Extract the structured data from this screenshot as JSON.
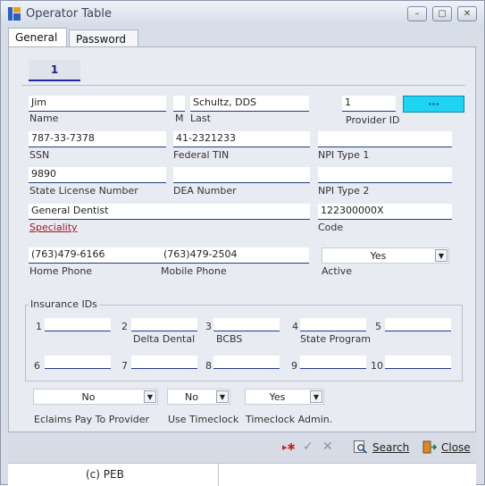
{
  "window": {
    "title": "Operator Table",
    "buttons": [
      "–",
      "▢",
      "✕"
    ]
  },
  "tabs": [
    "General",
    "Password"
  ],
  "page_tab": "1",
  "form": {
    "first_name": "Jim",
    "middle": "",
    "last_name": "Schultz, DDS",
    "provider_id": "1",
    "ellipsis_label": "···",
    "ssn": "787-33-7378",
    "federal_tin": "41-2321233",
    "npi_type1": "",
    "state_license": "9890",
    "dea_number": "",
    "npi_type2": "",
    "speciality": "General Dentist",
    "code": "122300000X",
    "home_phone": "(763)479-6166",
    "mobile_phone": "(763)479-2504",
    "active": "Yes"
  },
  "labels": {
    "name": "Name",
    "m": "M",
    "last": "Last",
    "provider_id": "Provider ID",
    "ssn": "SSN",
    "federal_tin": "Federal TIN",
    "npi_type1": "NPI Type 1",
    "state_license": "State License Number",
    "dea_number": "DEA Number",
    "npi_type2": "NPI Type 2",
    "speciality": "Speciality",
    "code": "Code",
    "home_phone": "Home Phone",
    "mobile_phone": "Mobile Phone",
    "active": "Active",
    "eclaims": "Eclaims Pay To Provider",
    "use_timeclock": "Use Timeclock",
    "timeclock_admin": "Timeclock Admin."
  },
  "insurance": {
    "title": "Insurance IDs",
    "numbers": [
      "1",
      "2",
      "3",
      "4",
      "5",
      "6",
      "7",
      "8",
      "9",
      "10"
    ],
    "captions": [
      "Delta Dental",
      "BCBS",
      "State Program"
    ]
  },
  "bottom_selects": {
    "eclaims": "No",
    "use_timeclock": "No",
    "timeclock_admin": "Yes"
  },
  "toolbar": {
    "search": "Search",
    "close": "Close"
  },
  "status": {
    "copyright": "(c) PEB"
  },
  "colors": {
    "accent_cyan": "#1fd3f2",
    "field_underline": "#1f3b8c",
    "link_red": "#9b1c1c"
  }
}
